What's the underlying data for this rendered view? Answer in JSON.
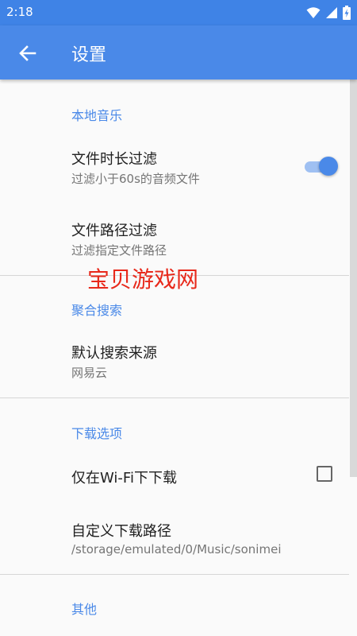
{
  "status_bar": {
    "time": "2:18"
  },
  "app_bar": {
    "title": "设置"
  },
  "sections": {
    "local_music": {
      "header": "本地音乐",
      "duration_filter": {
        "title": "文件时长过滤",
        "summary": "过滤小于60s的音频文件",
        "enabled": true
      },
      "path_filter": {
        "title": "文件路径过滤",
        "summary": "过滤指定文件路径"
      }
    },
    "aggregate_search": {
      "header": "聚合搜索",
      "default_source": {
        "title": "默认搜索来源",
        "summary": "网易云"
      }
    },
    "download": {
      "header": "下载选项",
      "wifi_only": {
        "title": "仅在Wi-Fi下下载",
        "checked": false
      },
      "custom_path": {
        "title": "自定义下载路径",
        "summary": "/storage/emulated/0/Music/sonimei"
      }
    },
    "other": {
      "header": "其他"
    }
  },
  "watermark": "宝贝游戏网",
  "colors": {
    "primary": "#4a89e8",
    "status_bar": "#3f83e6",
    "watermark": "#e8291b"
  }
}
